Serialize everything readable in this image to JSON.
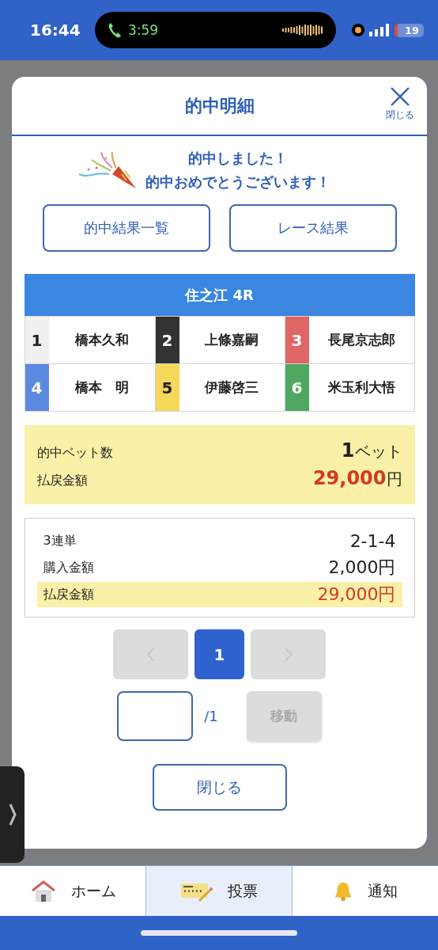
{
  "status_bar": {
    "time": "16:44",
    "call_time": "3:59",
    "battery": "19"
  },
  "modal": {
    "title": "的中明細",
    "close_label": "閉じる",
    "messages": [
      "的中しました！",
      "的中おめでとうございます！"
    ],
    "buttons": [
      "的中結果一覧",
      "レース結果"
    ],
    "race": {
      "title": "住之江 4R",
      "racers": [
        {
          "number": "1",
          "name": "橋本久和",
          "color": "#f0f0f0"
        },
        {
          "number": "2",
          "name": "上條嘉嗣",
          "color": "#333333"
        },
        {
          "number": "3",
          "name": "長尾京志郎",
          "color": "#e06666"
        },
        {
          "number": "4",
          "name": "橋本　明",
          "color": "#5b8be0"
        },
        {
          "number": "5",
          "name": "伊藤啓三",
          "color": "#f5d85a"
        },
        {
          "number": "6",
          "name": "米玉利大悟",
          "color": "#4fa860"
        }
      ]
    },
    "summary": [
      {
        "label": "的中ベット数",
        "value": "1",
        "unit": "ベット",
        "kind": "count"
      },
      {
        "label": "払戻金額",
        "value": "29,000",
        "unit": "円",
        "kind": "money"
      }
    ],
    "bets": [
      {
        "label": "3連単",
        "value": "2-1-4",
        "highlight": false
      },
      {
        "label": "購入金額",
        "value": "2,000円",
        "highlight": false
      },
      {
        "label": "払戻金額",
        "value": "29,000円",
        "highlight": true
      }
    ],
    "pagination": {
      "prev_disabled": true,
      "next_disabled": true,
      "pages": [
        {
          "label": "1",
          "selected": true
        }
      ]
    },
    "jump": {
      "total": "/1",
      "button": "移動",
      "disabled": true
    },
    "close_button": "閉じる"
  },
  "nav": [
    {
      "label": "ホーム",
      "selected": false
    },
    {
      "label": "投票",
      "selected": true
    },
    {
      "label": "通知",
      "selected": false
    }
  ]
}
